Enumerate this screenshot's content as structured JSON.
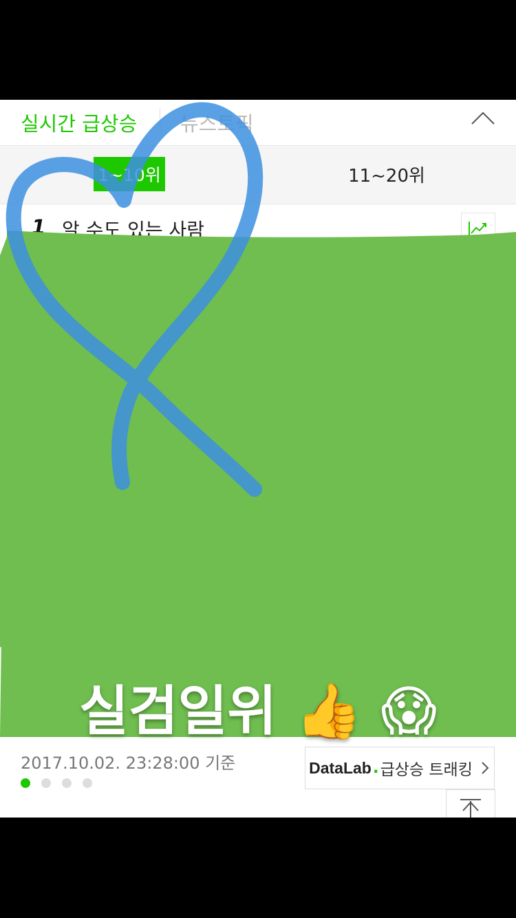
{
  "header": {
    "tab_main": "실시간 급상승",
    "tab_second": "뉴스토픽"
  },
  "ranges": {
    "active_label": "1~10위",
    "second_label": "11~20위"
  },
  "rank_list": [
    {
      "rank": "1",
      "keyword": "알 수도 있는 사람"
    }
  ],
  "overlay": {
    "caption": "실검일위 👍 😱",
    "green_color": "#6fbe4f",
    "heart_color": "#3d8fe0"
  },
  "footer": {
    "timestamp": "2017.10.02. 23:28:00 기준",
    "datalab_brand": "DataLab",
    "datalab_suffix": "급상승 트래킹",
    "page_dots": 4,
    "active_dot": 1
  },
  "colors": {
    "accent": "#1ec800"
  },
  "icons": [
    "chevron-up-icon",
    "trend-chart-icon",
    "chevron-right-icon",
    "to-top-icon"
  ]
}
